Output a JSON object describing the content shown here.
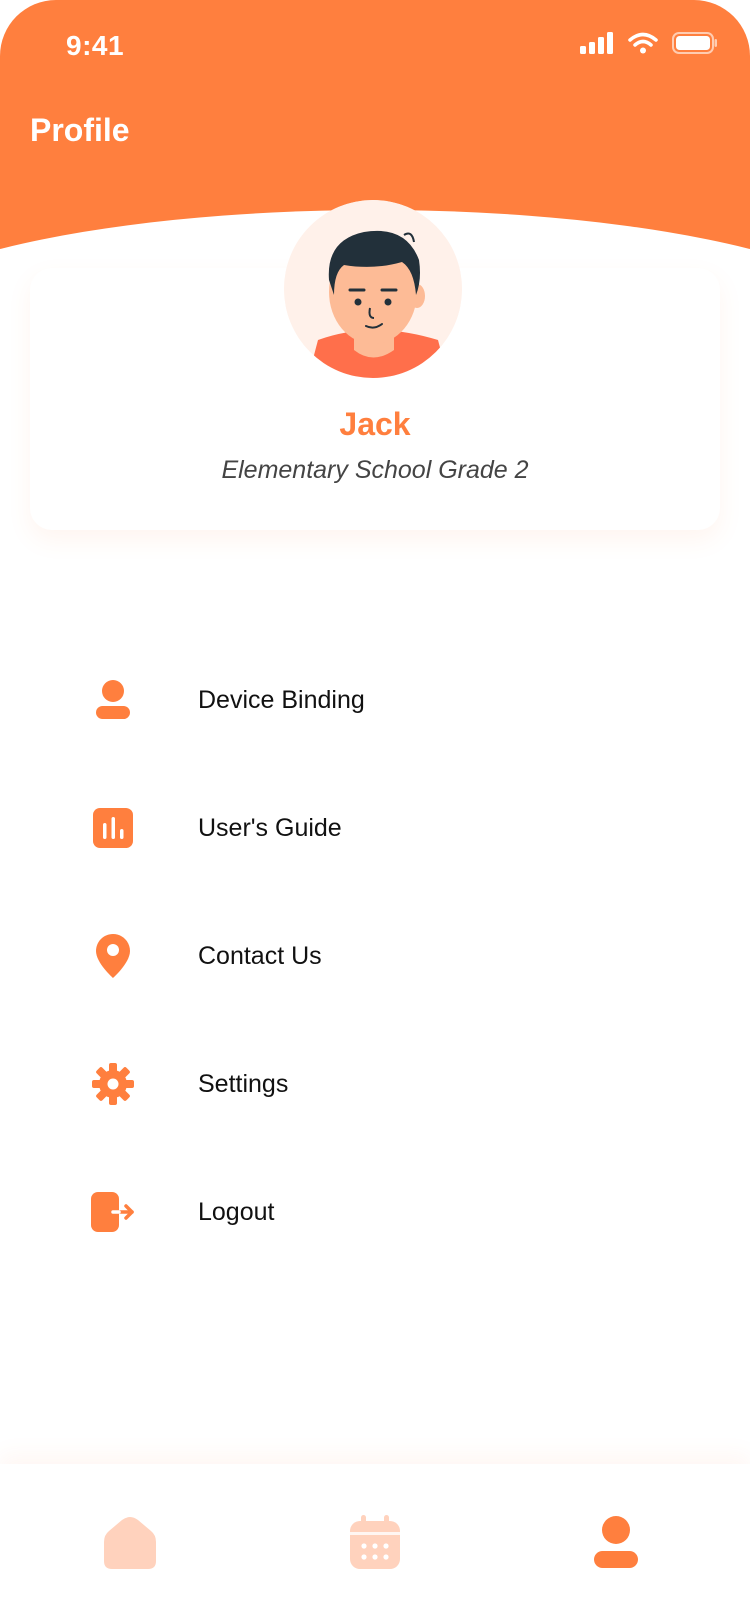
{
  "status_bar": {
    "time": "9:41"
  },
  "header": {
    "title": "Profile"
  },
  "profile": {
    "name": "Jack",
    "grade": "Elementary School Grade 2"
  },
  "menu": {
    "items": [
      {
        "label": "Device Binding",
        "icon": "person-icon"
      },
      {
        "label": "User's Guide",
        "icon": "chart-book-icon"
      },
      {
        "label": "Contact Us",
        "icon": "location-pin-icon"
      },
      {
        "label": "Settings",
        "icon": "gear-icon"
      },
      {
        "label": "Logout",
        "icon": "logout-icon"
      }
    ]
  },
  "bottom_nav": {
    "items": [
      {
        "name": "home",
        "icon": "home-icon",
        "active": false
      },
      {
        "name": "calendar",
        "icon": "calendar-icon",
        "active": false
      },
      {
        "name": "profile",
        "icon": "person-icon",
        "active": true
      }
    ]
  },
  "colors": {
    "accent": "#FF7F3E",
    "inactive": "#FFD2BD",
    "text": "#111111"
  }
}
